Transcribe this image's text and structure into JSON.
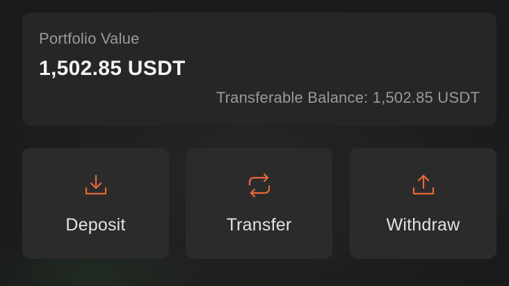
{
  "portfolio": {
    "label": "Portfolio Value",
    "amount": "1,502.85 USDT",
    "transferable_text": "Transferable Balance: 1,502.85 USDT"
  },
  "actions": [
    {
      "label": "Deposit",
      "icon": "download-icon"
    },
    {
      "label": "Transfer",
      "icon": "transfer-arrows-icon"
    },
    {
      "label": "Withdraw",
      "icon": "upload-icon"
    }
  ],
  "colors": {
    "accent": "#e8693c",
    "card_background": "#262626",
    "action_background": "#2b2b2b",
    "text_primary": "#f2f2f2",
    "text_secondary": "#9a9a9a"
  }
}
